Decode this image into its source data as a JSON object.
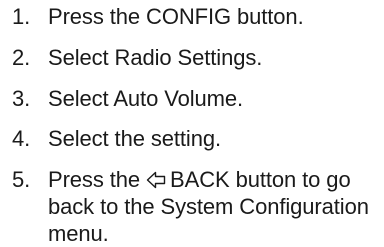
{
  "steps": [
    {
      "number": "1.",
      "text": "Press the CONFIG button."
    },
    {
      "number": "2.",
      "text": "Select Radio Settings."
    },
    {
      "number": "3.",
      "text": "Select Auto Volume."
    },
    {
      "number": "4.",
      "text": "Select the setting."
    },
    {
      "number": "5.",
      "text_before": "Press the",
      "text_after": "BACK button to go back to the System Configuration menu.",
      "icon": "back-arrow-icon"
    }
  ]
}
